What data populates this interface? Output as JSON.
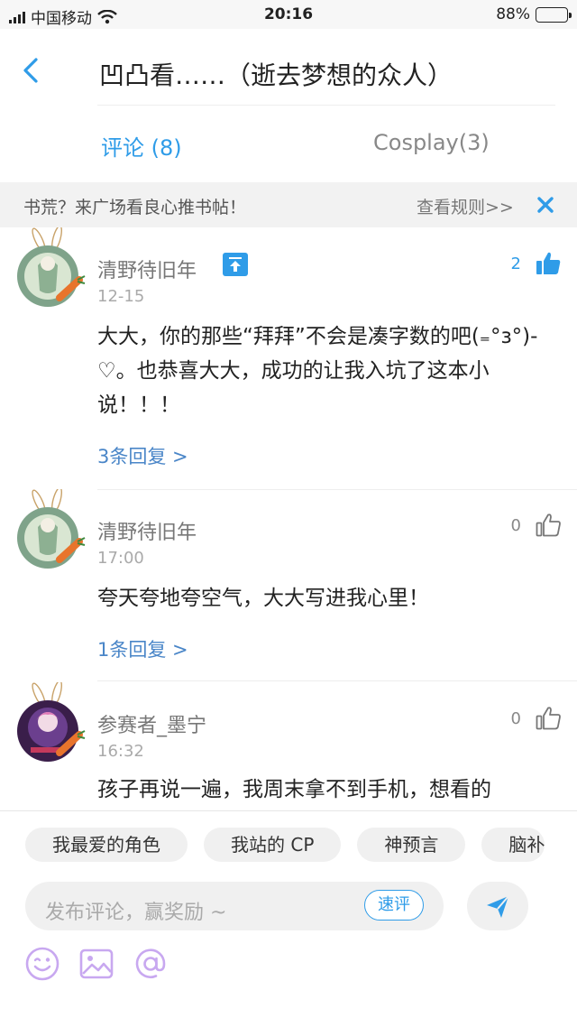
{
  "status_bar": {
    "carrier": "中国移动",
    "time": "20:16",
    "battery": "88%",
    "battery_level": 0.88
  },
  "nav": {
    "title": "凹凸看……（逝去梦想的众人）"
  },
  "tabs": [
    {
      "label": "评论 (8)",
      "active": true
    },
    {
      "label": "Cosplay(3)",
      "active": false
    }
  ],
  "notice": {
    "text": "书荒？来广场看良心推书帖！",
    "link": "查看规则>>"
  },
  "comments": [
    {
      "user": "清野待旧年",
      "date": "12-15",
      "likes": "2",
      "liked": true,
      "text": "大大，你的那些“拜拜”不会是凑字数的吧(₌°з°)-♡。也恭喜大大，成功的让我入坑了这本小说！！！",
      "replies": "3条回复 >"
    },
    {
      "user": "清野待旧年",
      "date": "17:00",
      "likes": "0",
      "liked": false,
      "text": "夸天夸地夸空气，大大写进我心里！",
      "replies": "1条回复 >"
    },
    {
      "user": "参赛者_墨宁",
      "date": "16:32",
      "likes": "0",
      "liked": false,
      "text": "孩子再说一遍，我周末拿不到手机，想看的"
    }
  ],
  "chips": [
    "我最爱的角色",
    "我站的 CP",
    "神预言",
    "脑补"
  ],
  "composer": {
    "placeholder": "发布评论，赢奖励 ~",
    "quick_label": "速评"
  },
  "colors": {
    "accent": "#2f9ce8",
    "reply": "#4a86c8",
    "tool_purple": "#c8a8f0"
  }
}
